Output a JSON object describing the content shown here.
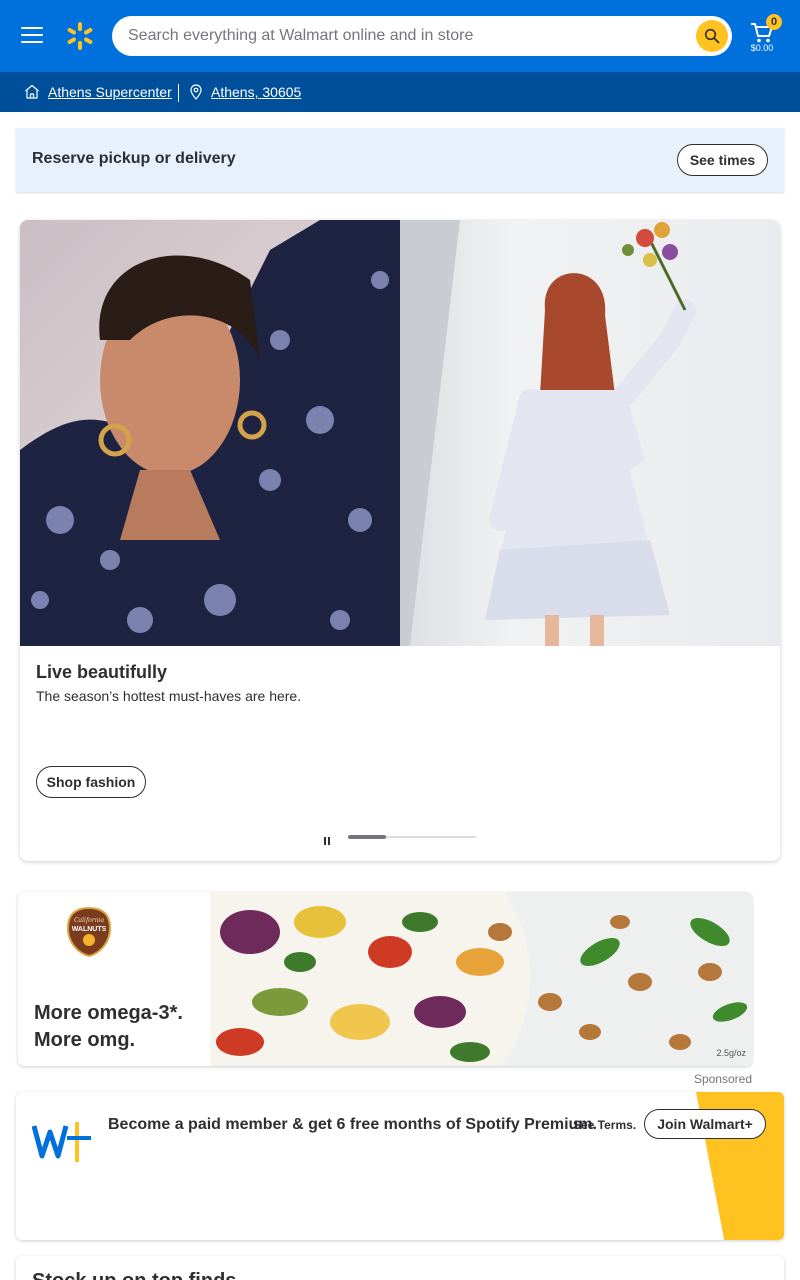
{
  "header": {
    "search_placeholder": "Search everything at Walmart online and in store",
    "cart_count": "0",
    "cart_total": "$0.00",
    "colors": {
      "brand_blue": "#0071dc",
      "spark_yellow": "#ffc220"
    }
  },
  "location": {
    "store_label": "Athens Supercenter",
    "zip_label": "Athens, 30605"
  },
  "reserve": {
    "text": "Reserve pickup or delivery",
    "button_label": "See times"
  },
  "hero": {
    "title": "Live beautifully",
    "subtitle": "The season’s hottest must-haves are here.",
    "button_label": "Shop fashion",
    "carousel_progress": 0.3
  },
  "ad": {
    "logo_line1": "California",
    "logo_line2": "WALNUTS",
    "headline_line1": "More omega-3*.",
    "headline_line2": "More omg.",
    "footnote": "2.5g/oz",
    "sponsored_label": "Sponsored"
  },
  "walmart_plus": {
    "text": "Become a paid member & get 6 free months of Spotify Premium.",
    "terms_label": "See Terms.",
    "button_label": "Join Walmart+"
  },
  "next_section": {
    "title": "Stock up on top finds"
  }
}
